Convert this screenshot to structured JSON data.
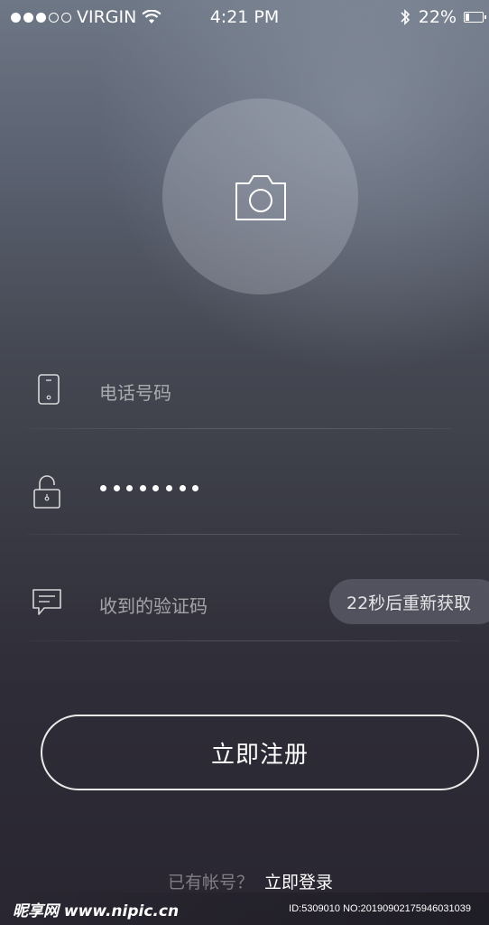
{
  "status_bar": {
    "carrier": "VIRGIN",
    "time": "4:21 PM",
    "battery": "22%",
    "battery_level": 0.22
  },
  "form": {
    "phone_placeholder": "电话号码",
    "code_placeholder": "收到的验证码",
    "resend_label": "22秒后重新获取",
    "register_label": "立即注册"
  },
  "footer": {
    "question": "已有帐号？",
    "login_link": "立即登录"
  },
  "watermark": {
    "logo": "昵享网 www.nipic.cn",
    "id_text": "ID:5309010 NO:20190902175946031039"
  },
  "icons": {
    "avatar": "camera-icon",
    "phone": "phone-icon",
    "password": "lock-icon",
    "code": "message-icon"
  }
}
